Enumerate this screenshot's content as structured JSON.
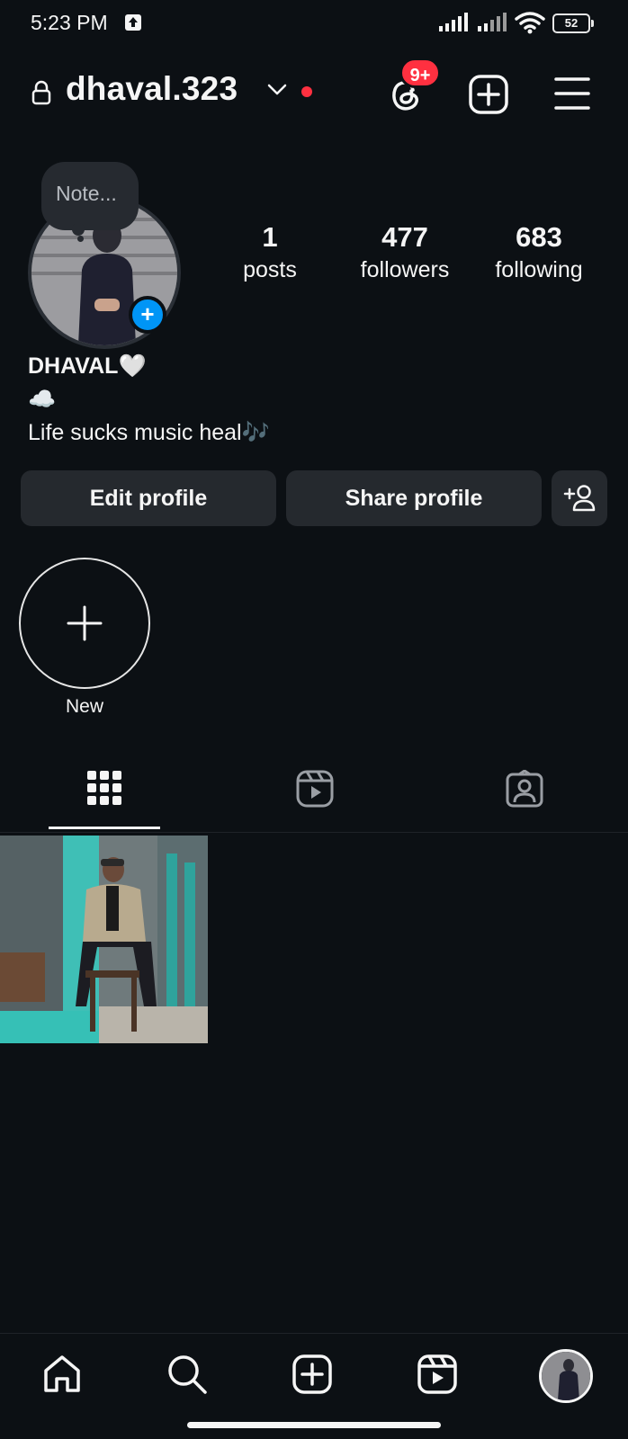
{
  "status_bar": {
    "time": "5:23 PM",
    "battery": "52",
    "icons": [
      "upload-icon",
      "signal-icon",
      "signal-icon",
      "wifi-icon",
      "battery-icon"
    ]
  },
  "header": {
    "username": "dhaval.323",
    "notification_badge": "9+",
    "icons": [
      "lock-icon",
      "chevron-down-icon",
      "threads-icon",
      "create-icon",
      "menu-icon"
    ]
  },
  "profile": {
    "note_placeholder": "Note...",
    "stats": {
      "posts_count": "1",
      "posts_label": "posts",
      "followers_count": "477",
      "followers_label": "followers",
      "following_count": "683",
      "following_label": "following"
    },
    "display_name": "DHAVAL🤍",
    "bio_line1": "☁️",
    "bio_line2": "Life sucks music heal🎶"
  },
  "actions": {
    "edit_profile": "Edit profile",
    "share_profile": "Share profile"
  },
  "highlights": {
    "new_label": "New"
  },
  "tabs": [
    "grid-icon",
    "reels-icon",
    "tagged-icon"
  ],
  "bottom_nav": [
    "home-icon",
    "search-icon",
    "create-icon",
    "reels-icon",
    "profile-avatar"
  ],
  "colors": {
    "background": "#0c1014",
    "button": "#25292e",
    "badge_red": "#ff3040",
    "blue": "#0095f6",
    "text": "#f5f5f5"
  }
}
